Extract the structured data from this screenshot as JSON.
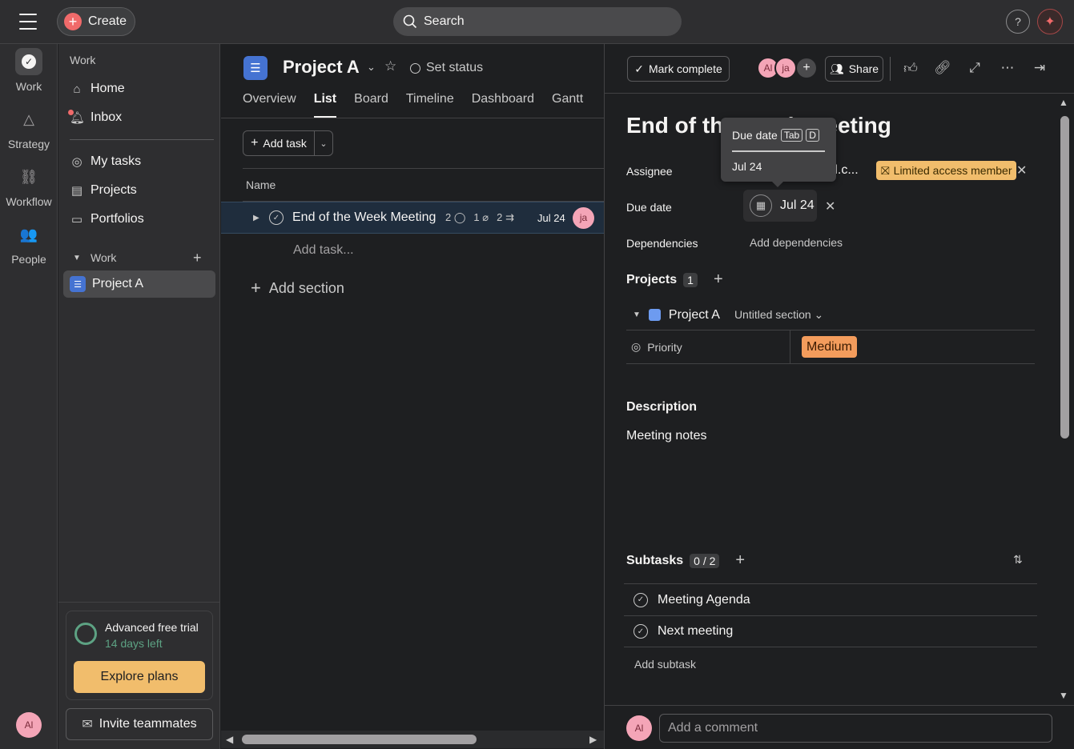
{
  "topbar": {
    "create_label": "Create",
    "search_placeholder": "Search",
    "help_label": "?"
  },
  "rail": {
    "items": [
      {
        "label": "Work",
        "icon": "check-icon"
      },
      {
        "label": "Strategy",
        "icon": "triangle-icon"
      },
      {
        "label": "Workflow",
        "icon": "workflow-icon"
      },
      {
        "label": "People",
        "icon": "people-icon"
      }
    ],
    "user_initials": "Al"
  },
  "sidebar": {
    "heading": "Work",
    "items": [
      {
        "label": "Home",
        "icon": "home-icon"
      },
      {
        "label": "Inbox",
        "icon": "bell-icon"
      },
      {
        "label": "My tasks",
        "icon": "check-circle-icon"
      },
      {
        "label": "Projects",
        "icon": "clipboard-icon"
      },
      {
        "label": "Portfolios",
        "icon": "folder-icon"
      }
    ],
    "section_label": "Work",
    "projects": [
      {
        "label": "Project A"
      }
    ],
    "trial": {
      "title": "Advanced free trial",
      "subtitle": "14 days left",
      "button": "Explore plans"
    },
    "invite_label": "Invite teammates"
  },
  "project": {
    "title": "Project A",
    "set_status": "Set status",
    "tabs": [
      "Overview",
      "List",
      "Board",
      "Timeline",
      "Dashboard",
      "Gantt"
    ],
    "active_tab": "List",
    "add_task_label": "Add task",
    "column_name": "Name",
    "tasks": [
      {
        "name": "End of the Week Meeting",
        "comments": "2",
        "attachments": "1",
        "subtasks": "2",
        "due": "Jul 24",
        "assignee_initials": "ja"
      }
    ],
    "add_task_row": "Add task...",
    "add_section": "Add section"
  },
  "detail": {
    "mark_complete": "Mark complete",
    "collaborators": [
      "Al",
      "ja"
    ],
    "share_label": "Share",
    "title": "End of the Week Meeting",
    "assignee_label": "Assignee",
    "assignee_value": "d.c...",
    "limited_access": "Limited access member",
    "due_label": "Due date",
    "due_value": "Jul 24",
    "dependencies_label": "Dependencies",
    "add_dependencies": "Add dependencies",
    "projects_label": "Projects",
    "projects_count": "1",
    "project_name": "Project A",
    "section_name": "Untitled section",
    "priority_label": "Priority",
    "priority_value": "Medium",
    "description_label": "Description",
    "description_body": "Meeting notes",
    "subtasks_label": "Subtasks",
    "subtasks_count": "0 / 2",
    "subtasks": [
      "Meeting Agenda",
      "Next meeting"
    ],
    "add_subtask": "Add subtask",
    "comment_placeholder": "Add a comment",
    "commenter_initials": "Al"
  },
  "tooltip": {
    "title": "Due date",
    "key1": "Tab",
    "key2": "D",
    "date": "Jul 24"
  },
  "colors": {
    "accent_red": "#f06a6a",
    "project_blue": "#4573d2",
    "limited_badge": "#f1bd6c",
    "priority_medium": "#f39c5c",
    "trial_green": "#5da283"
  }
}
